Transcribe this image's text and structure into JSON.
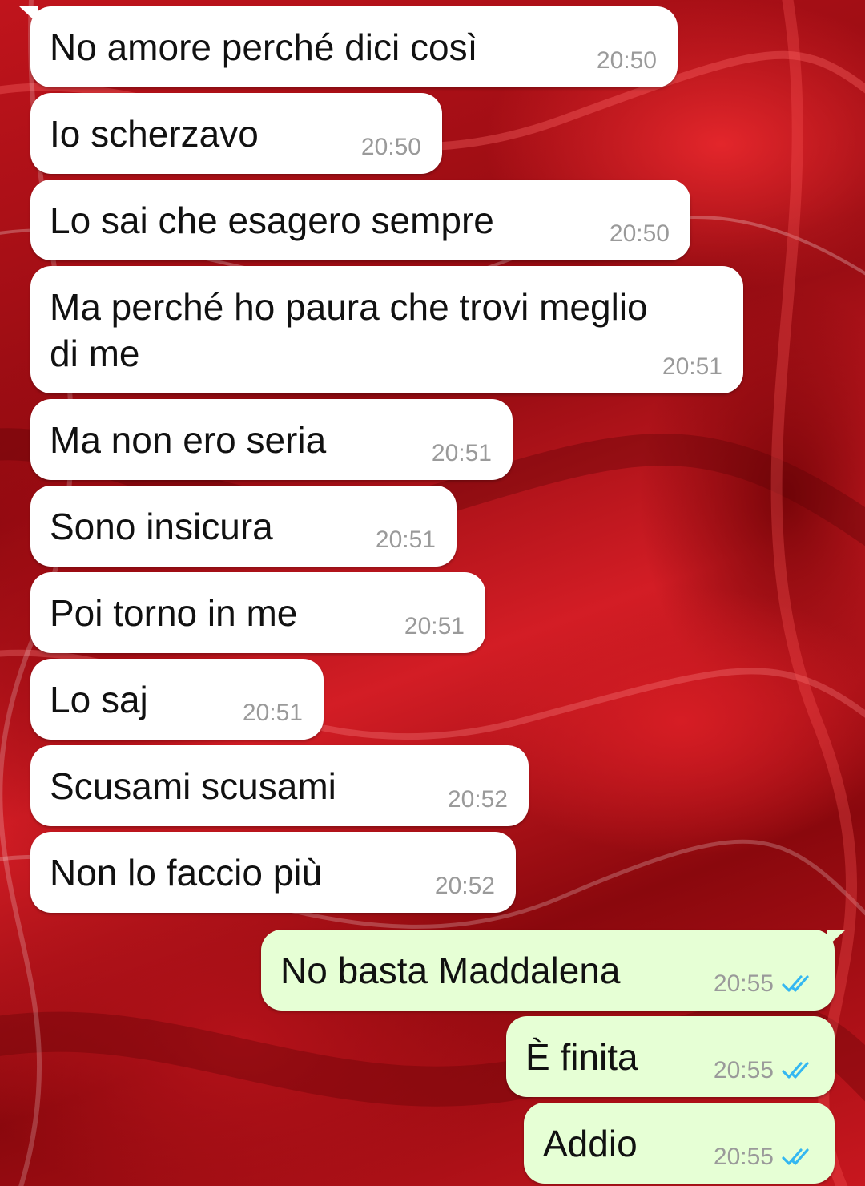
{
  "conversation": {
    "incoming": [
      {
        "text": "No amore perché dici così",
        "time": "20:50"
      },
      {
        "text": "Io scherzavo",
        "time": "20:50"
      },
      {
        "text": "Lo sai che esagero sempre",
        "time": "20:50"
      },
      {
        "text": "Ma perché ho paura che trovi meglio\ndi me",
        "time": "20:51"
      },
      {
        "text": "Ma non ero seria",
        "time": "20:51"
      },
      {
        "text": "Sono insicura",
        "time": "20:51"
      },
      {
        "text": "Poi torno in me",
        "time": "20:51"
      },
      {
        "text": "Lo saj",
        "time": "20:51"
      },
      {
        "text": "Scusami scusami",
        "time": "20:52"
      },
      {
        "text": "Non lo faccio più",
        "time": "20:52"
      }
    ],
    "outgoing": [
      {
        "text": "No basta Maddalena",
        "time": "20:55",
        "status_icon": "double-check-icon"
      },
      {
        "text": "È finita",
        "time": "20:55",
        "status_icon": "double-check-icon"
      },
      {
        "text": "Addio",
        "time": "20:55",
        "status_icon": "double-check-icon"
      }
    ]
  },
  "colors": {
    "incoming_bubble": "#ffffff",
    "outgoing_bubble": "#e6ffd5",
    "read_tick": "#34b7f1",
    "background_base": "#b0111a"
  }
}
